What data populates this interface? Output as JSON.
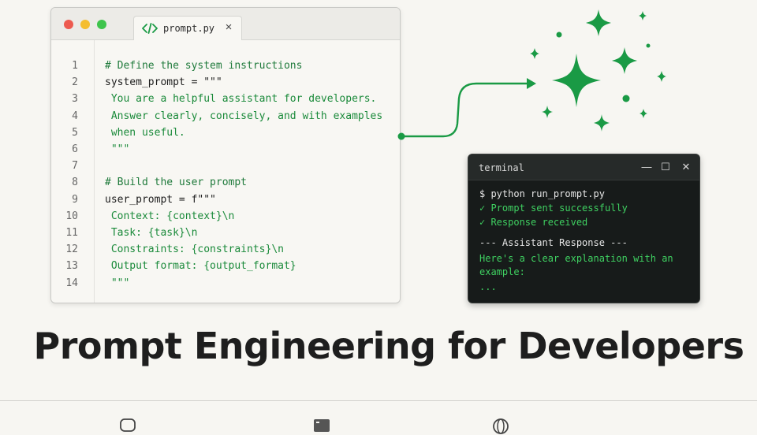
{
  "editor": {
    "tab_label": "prompt.py",
    "close_glyph": "×",
    "tab_icon": "code-icon",
    "lines": [
      {
        "n": "1",
        "text": "# Define the system instructions",
        "kind": "comment"
      },
      {
        "n": "2",
        "text": "system_prompt = \"\"\"",
        "kind": "plain"
      },
      {
        "n": "3",
        "text": " You are a helpful assistant for developers.",
        "kind": "string"
      },
      {
        "n": "4",
        "text": " Answer clearly, concisely, and with examples",
        "kind": "string"
      },
      {
        "n": "5",
        "text": " when useful.",
        "kind": "string"
      },
      {
        "n": "6",
        "text": " \"\"\"",
        "kind": "string"
      },
      {
        "n": "7",
        "text": "",
        "kind": "plain"
      },
      {
        "n": "8",
        "text": "# Build the user prompt",
        "kind": "comment"
      },
      {
        "n": "9",
        "text": "user_prompt = f\"\"\"",
        "kind": "plain"
      },
      {
        "n": "10",
        "text": " Context: {context}\\n",
        "kind": "string"
      },
      {
        "n": "11",
        "text": " Task: {task}\\n",
        "kind": "string"
      },
      {
        "n": "12",
        "text": " Constraints: {constraints}\\n",
        "kind": "string"
      },
      {
        "n": "13",
        "text": " Output format: {output_format}",
        "kind": "string"
      },
      {
        "n": "14",
        "text": " \"\"\"",
        "kind": "string"
      }
    ]
  },
  "terminal": {
    "title": "terminal",
    "minimize_glyph": "—",
    "maximize_glyph": "☐",
    "close_glyph": "✕",
    "lines": [
      {
        "text": "$ python run_prompt.py",
        "kind": "white"
      },
      {
        "text": "✓ Prompt sent successfully",
        "kind": "green"
      },
      {
        "text": "✓ Response received",
        "kind": "green"
      },
      {
        "text": "--- Assistant Response ---",
        "kind": "white"
      },
      {
        "text": "Here's a clear explanation with an",
        "kind": "green"
      },
      {
        "text": "example:",
        "kind": "green"
      },
      {
        "text": "...",
        "kind": "green"
      }
    ]
  },
  "headline": "Prompt Engineering for Developers",
  "footer_icons": [
    "chat-icon",
    "terminal-icon",
    "globe-icon"
  ],
  "colors": {
    "accent_green": "#1a9a45",
    "background": "#f7f6f2",
    "terminal_bg": "#171b1a"
  }
}
